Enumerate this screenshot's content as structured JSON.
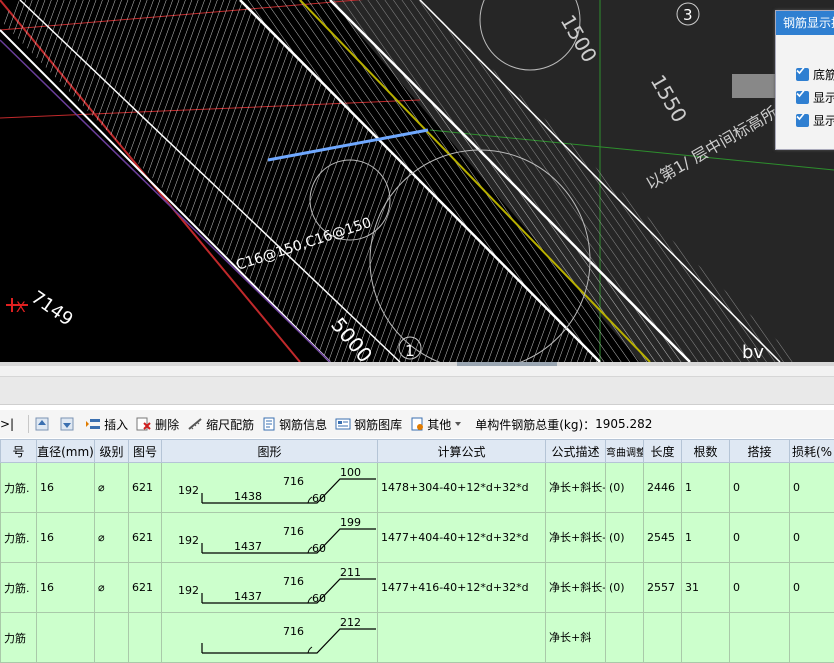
{
  "viewport": {
    "label_7149": "7149",
    "axis_x": "X",
    "rebar_note": "C16@150,C16@150",
    "axis_num_3": "3",
    "axis_num_1": "1",
    "view_label": "bv",
    "side_text": "以第1/ 层中间标高所",
    "dim_top": "1500",
    "dim_mid": "1550",
    "dim_bottom": "5000"
  },
  "dialog": {
    "title": "钢筋显示控",
    "options": [
      "底筋",
      "显示",
      "显示"
    ]
  },
  "toolbar": {
    "nav_first": "|<",
    "nav_last": ">|",
    "insert": "插入",
    "delete": "删除",
    "scale_rebar": "缩尺配筋",
    "rebar_info": "钢筋信息",
    "rebar_library": "钢筋图库",
    "other": "其他",
    "total_weight_label": "单构件钢筋总重(kg)：",
    "total_weight_value": "1905.282"
  },
  "table": {
    "headers": [
      "号",
      "直径(mm)",
      "级别",
      "图号",
      "图形",
      "计算公式",
      "公式描述",
      "弯曲调整",
      "长度",
      "根数",
      "搭接",
      "损耗(%"
    ],
    "rows": [
      {
        "name": "力筋.",
        "dia": "16",
        "grade": "⌀",
        "fig": "621",
        "s_left": "192",
        "s_bottom": "1438",
        "s_top": "716",
        "s_right": "100",
        "s_angle": "60",
        "formula": "1478+304-40+12*d+32*d",
        "desc": "净长+斜长-保…",
        "bend": "(0)",
        "length": "2446",
        "count": "1",
        "lap": "0",
        "loss": "0"
      },
      {
        "name": "力筋.",
        "dia": "16",
        "grade": "⌀",
        "fig": "621",
        "s_left": "192",
        "s_bottom": "1437",
        "s_top": "716",
        "s_right": "199",
        "s_angle": "60",
        "formula": "1477+404-40+12*d+32*d",
        "desc": "净长+斜长-保…",
        "bend": "(0)",
        "length": "2545",
        "count": "1",
        "lap": "0",
        "loss": "0"
      },
      {
        "name": "力筋.",
        "dia": "16",
        "grade": "⌀",
        "fig": "621",
        "s_left": "192",
        "s_bottom": "1437",
        "s_top": "716",
        "s_right": "211",
        "s_angle": "60",
        "formula": "1477+416-40+12*d+32*d",
        "desc": "净长+斜长-保…",
        "bend": "(0)",
        "length": "2557",
        "count": "31",
        "lap": "0",
        "loss": "0"
      },
      {
        "name": "力筋",
        "dia": "",
        "grade": "",
        "fig": "",
        "s_left": "",
        "s_bottom": "",
        "s_top": "716",
        "s_right": "212",
        "s_angle": "",
        "formula": "",
        "desc": "净长+斜",
        "bend": "",
        "length": "",
        "count": "",
        "lap": "",
        "loss": ""
      }
    ]
  }
}
